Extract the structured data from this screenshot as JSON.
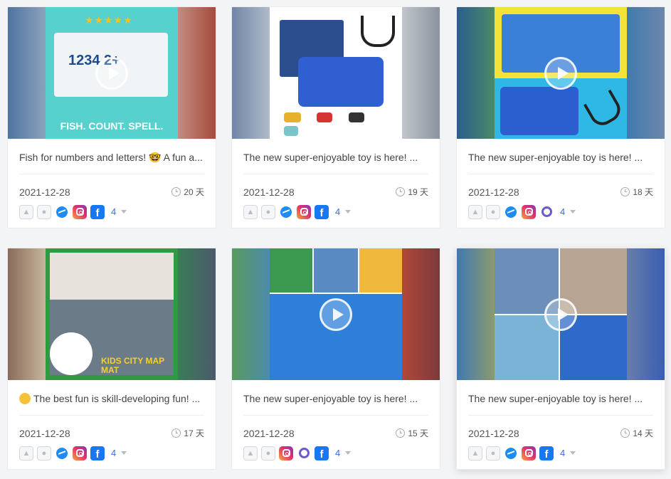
{
  "posts": [
    {
      "description": "Fish for numbers and letters! 🤓 A fun a...",
      "date": "2021-12-28",
      "days_ago": "20 天",
      "platform_count": "4",
      "platforms": [
        "android-icon",
        "apple-icon",
        "messenger-icon",
        "instagram-icon",
        "facebook-icon"
      ],
      "thumb_text": "FISH. COUNT. SPELL.",
      "thumb_sub": "1234 2+",
      "colors": {
        "left": "#6a86a6",
        "right": "#b97061",
        "thumb": "#57d1cd"
      }
    },
    {
      "description": "The new super-enjoyable toy is here! ...",
      "date": "2021-12-28",
      "days_ago": "19 天",
      "platform_count": "4",
      "platforms": [
        "android-icon",
        "apple-icon",
        "messenger-icon",
        "instagram-icon",
        "facebook-icon"
      ],
      "colors": {
        "left": "#8293a8",
        "right": "#9fa5ad",
        "thumb": "#f4f5f8"
      }
    },
    {
      "description": "The new super-enjoyable toy is here! ...",
      "date": "2021-12-28",
      "days_ago": "18 天",
      "platform_count": "4",
      "platforms": [
        "android-icon",
        "apple-icon",
        "messenger-icon",
        "instagram-icon",
        "community-ring-icon"
      ],
      "colors": {
        "left": "#3a6f9c",
        "right": "#3f7fb4",
        "thumb": "#2fb8e6"
      }
    },
    {
      "description": "The best fun is skill-developing fun! ...",
      "date": "2021-12-28",
      "days_ago": "17 天",
      "platform_count": "4",
      "platforms": [
        "android-icon",
        "apple-icon",
        "messenger-icon",
        "instagram-icon",
        "facebook-icon"
      ],
      "thumb_text": "KIDS CITY MAP MAT",
      "colors": {
        "left": "#6d6b57",
        "right": "#3d6d53",
        "thumb": "#2f9a43"
      }
    },
    {
      "description": "The new super-enjoyable toy is here! ...",
      "date": "2021-12-28",
      "days_ago": "15 天",
      "platform_count": "4",
      "platforms": [
        "android-icon",
        "apple-icon",
        "instagram-icon",
        "community-ring-icon",
        "facebook-icon"
      ],
      "colors": {
        "left": "#4f8a5c",
        "right": "#a74b3f",
        "thumb": "#2ea3e0"
      }
    },
    {
      "description": "The new super-enjoyable toy is here! ...",
      "date": "2021-12-28",
      "days_ago": "14 天",
      "platform_count": "4",
      "platforms": [
        "android-icon",
        "apple-icon",
        "messenger-icon",
        "instagram-icon",
        "facebook-icon"
      ],
      "colors": {
        "left": "#4e7fa8",
        "right": "#6c7aa4",
        "thumb": "#dfe3e8"
      }
    }
  ]
}
